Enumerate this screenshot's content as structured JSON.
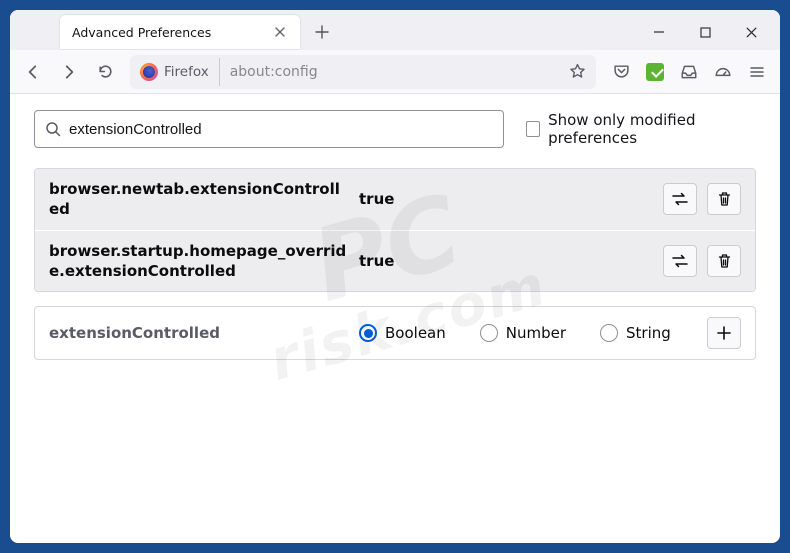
{
  "tab": {
    "title": "Advanced Preferences"
  },
  "urlbar": {
    "identity_label": "Firefox",
    "url": "about:config"
  },
  "config": {
    "search_value": "extensionControlled",
    "modified_only_label": "Show only modified preferences",
    "rows": [
      {
        "name": "browser.newtab.extensionControlled",
        "value": "true"
      },
      {
        "name": "browser.startup.homepage_override.extensionControlled",
        "value": "true"
      }
    ],
    "new_pref_name": "extensionControlled",
    "types": {
      "boolean": "Boolean",
      "number": "Number",
      "string": "String"
    }
  },
  "icons": {
    "close": "close-icon",
    "plus": "plus-icon",
    "back": "back-icon",
    "forward": "forward-icon",
    "reload": "reload-icon",
    "star": "star-icon",
    "pocket": "pocket-icon",
    "inbox": "inbox-icon",
    "dash": "dashboard-icon",
    "menu": "menu-icon",
    "search": "search-icon",
    "toggle": "toggle-icon",
    "trash": "trash-icon",
    "add": "add-icon",
    "minimize": "minimize-icon",
    "maximize": "maximize-icon"
  }
}
